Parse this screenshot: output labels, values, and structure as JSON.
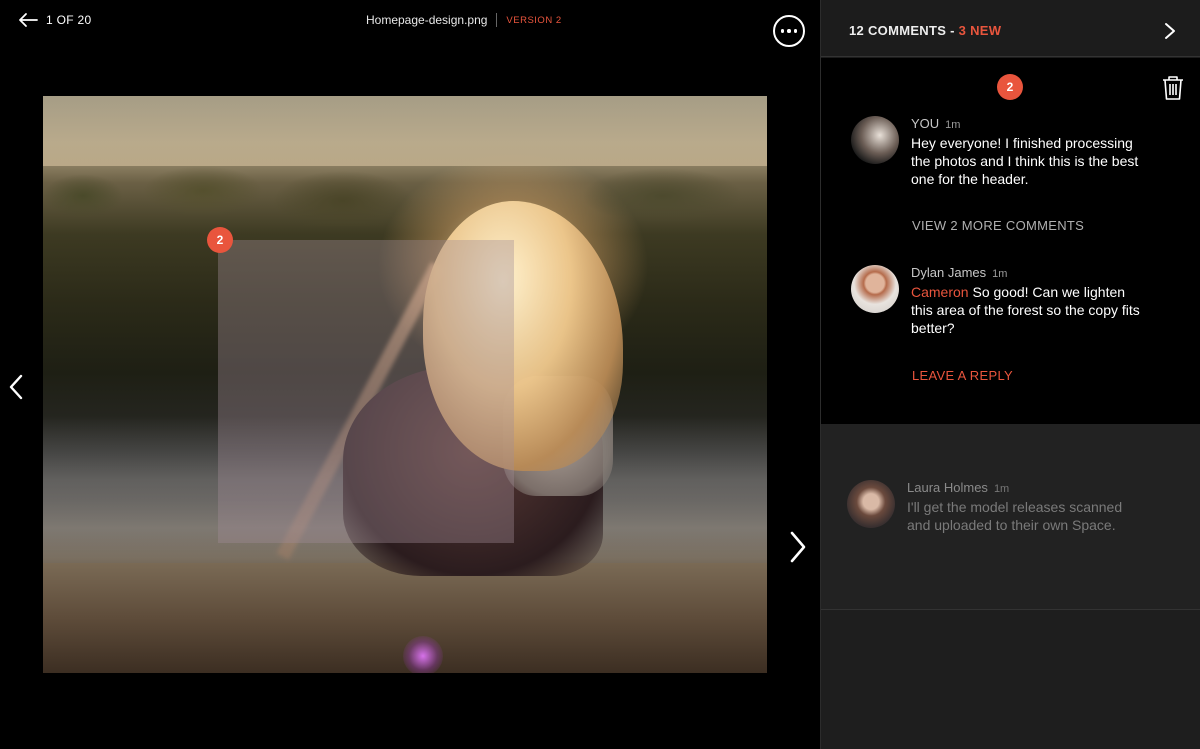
{
  "topbar": {
    "counter": "1 OF 20",
    "filename": "Homepage-design.png",
    "version": "VERSION 2"
  },
  "image": {
    "marker_number": "2"
  },
  "panel": {
    "comments_count": "12 COMMENTS - ",
    "new_count": "3 NEW",
    "thread_marker": "2",
    "comments": [
      {
        "author": "YOU",
        "time": "1m",
        "text": "Hey everyone! I finished processing the photos and I think this is the best one for the header."
      },
      {
        "author": "Dylan James",
        "time": "1m",
        "mention": "Cameron",
        "text": " So good! Can we lighten this area of the forest so the copy fits better?"
      }
    ],
    "view_more": "VIEW 2 MORE COMMENTS",
    "leave_reply": "LEAVE A REPLY",
    "other_comment": {
      "author": "Laura Holmes",
      "time": "1m",
      "text": "I'll get the model releases scanned and uploaded to their own Space."
    }
  },
  "colors": {
    "accent": "#e9553d",
    "panel_bg": "#1c1c1c",
    "viewer_bg": "#000000"
  },
  "icons": {
    "back": "arrow-left-icon",
    "more": "more-horizontal-icon",
    "prev": "chevron-left-icon",
    "next": "chevron-right-icon",
    "close_panel": "chevron-right-icon",
    "delete": "trash-icon"
  }
}
